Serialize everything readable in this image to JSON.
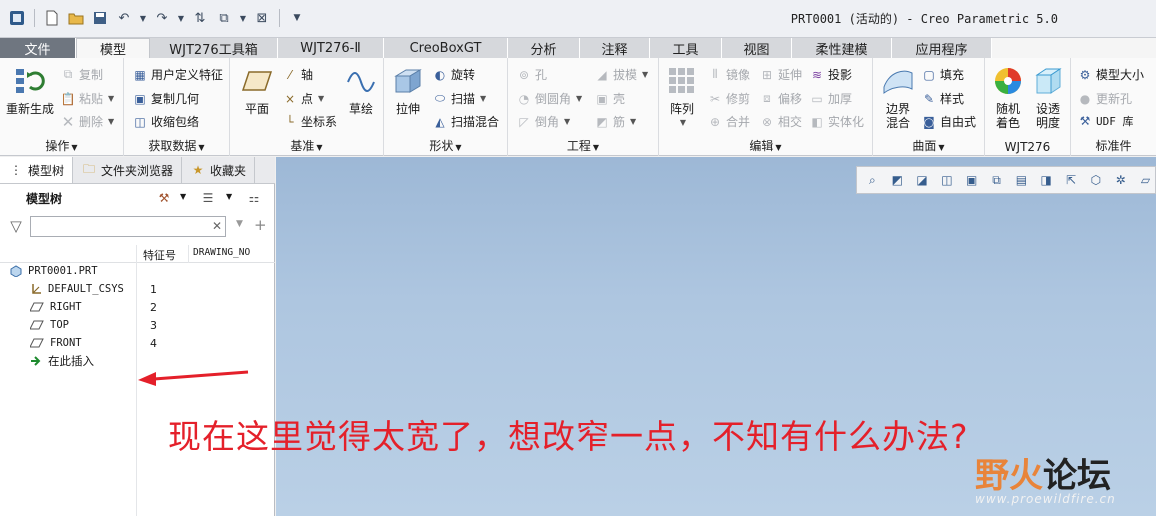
{
  "window": {
    "title": "PRT0001 (活动的) - Creo Parametric 5.0"
  },
  "tabs": [
    {
      "label": "文件"
    },
    {
      "label": "模型"
    },
    {
      "label": "WJT276工具箱"
    },
    {
      "label": "WJT276-Ⅱ"
    },
    {
      "label": "CreoBoxGT"
    },
    {
      "label": "分析"
    },
    {
      "label": "注释"
    },
    {
      "label": "工具"
    },
    {
      "label": "视图"
    },
    {
      "label": "柔性建模"
    },
    {
      "label": "应用程序"
    }
  ],
  "ribbon": {
    "operations": {
      "label": "操作",
      "regen": "重新生成",
      "copy": "复制",
      "paste": "粘贴",
      "delete": "删除"
    },
    "getdata": {
      "label": "获取数据",
      "udf": "用户定义特征",
      "copygeom": "复制几何",
      "shrinkwrap": "收缩包络"
    },
    "datum": {
      "label": "基准",
      "plane": "平面",
      "axis": "轴",
      "point": "点",
      "csys": "坐标系",
      "sketch": "草绘"
    },
    "shapes": {
      "label": "形状",
      "extrude": "拉伸",
      "revolve": "旋转",
      "sweep": "扫描",
      "sweptblend": "扫描混合"
    },
    "engineering": {
      "label": "工程",
      "hole": "孔",
      "round": "倒圆角",
      "chamfer": "倒角",
      "draft": "拔模",
      "shell": "壳",
      "rib": "筋"
    },
    "editing": {
      "label": "编辑",
      "pattern": "阵列",
      "mirror": "镜像",
      "trim": "修剪",
      "merge": "合并",
      "extend": "延伸",
      "offset": "偏移",
      "intersect": "相交",
      "project": "投影",
      "thicken": "加厚",
      "solidify": "实体化"
    },
    "surfaces": {
      "label": "曲面",
      "boundary": "边界\n混合",
      "fill": "填充",
      "style": "样式",
      "freestyle": "自由式"
    },
    "wjt": {
      "label": "WJT276",
      "randomcolor": "随机\n着色",
      "transparency": "设透\n明度"
    },
    "standard": {
      "label": "标准件",
      "modelsize": "模型大小",
      "updatehole": "更新孔",
      "udflib": "UDF 库"
    }
  },
  "panel": {
    "tabs": [
      {
        "label": "模型树"
      },
      {
        "label": "文件夹浏览器"
      },
      {
        "label": "收藏夹"
      }
    ],
    "tree_title": "模型树",
    "filter_value": "",
    "columns": {
      "feature_no": "特征号",
      "drawing_no": "DRAWING_NO"
    },
    "rows": [
      {
        "name": "PRT0001.PRT",
        "num": ""
      },
      {
        "name": "DEFAULT_CSYS",
        "num": "1"
      },
      {
        "name": "RIGHT",
        "num": "2"
      },
      {
        "name": "TOP",
        "num": "3"
      },
      {
        "name": "FRONT",
        "num": "4"
      },
      {
        "name": "在此插入",
        "num": ""
      }
    ]
  },
  "annotation": {
    "question": "现在这里觉得太宽了，想改窄一点，不知有什么办法?",
    "color": "#e4202a"
  },
  "watermark": {
    "brand_a": "野火",
    "brand_b": "论坛",
    "url": "www.proewildfire.cn"
  }
}
